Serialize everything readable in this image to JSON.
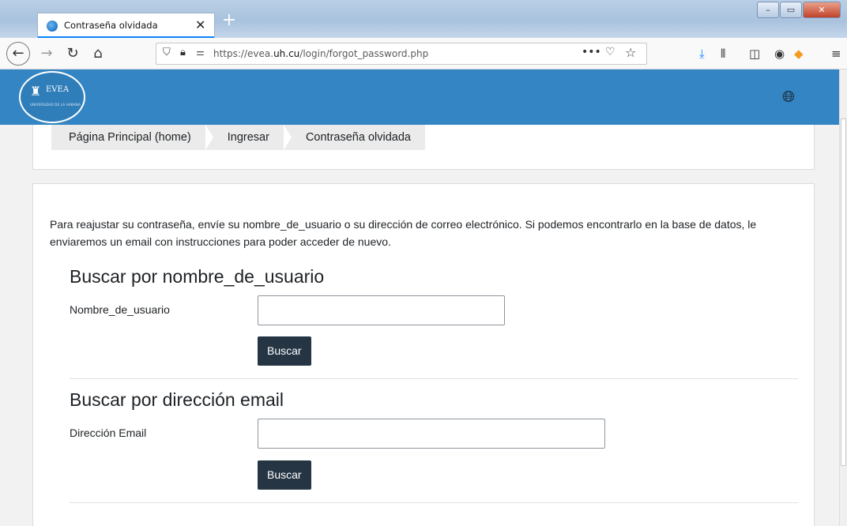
{
  "browser": {
    "tab_title": "Contraseña olvidada",
    "tab_close": "✕",
    "new_tab": "+",
    "url_prefix": "https://evea.",
    "url_domain": "uh.cu",
    "url_path": "/login/forgot_password.php",
    "window_controls": {
      "minimize": "–",
      "maximize": "▭",
      "close": "✕"
    },
    "icons": {
      "back": "back-arrow-icon",
      "forward": "forward-arrow-icon",
      "reload": "reload-icon",
      "home": "home-icon",
      "shield": "shield-icon",
      "lock": "lock-icon",
      "permissions": "permissions-icon",
      "more": "more-dots-icon",
      "pocket": "pocket-icon",
      "bookmark": "star-icon",
      "download": "download-icon",
      "library": "library-icon",
      "sidebar": "sidebar-icon",
      "menu": "hamburger-menu-icon"
    },
    "accent_color": "#0a84ff"
  },
  "site": {
    "header_color": "#3485c3",
    "logo_text": "EVEA",
    "logo_subtext": "UNIVERSIDAD DE LA HABANA",
    "language_icon": "globe-icon"
  },
  "breadcrumb": [
    {
      "label": "Página Principal (home)"
    },
    {
      "label": "Ingresar"
    },
    {
      "label": "Contraseña olvidada"
    }
  ],
  "main": {
    "instructions": "Para reajustar su contraseña, envíe su nombre_de_usuario o su dirección de correo electrónico. Si podemos encontrarlo en la base de datos, le enviaremos un email con instrucciones para poder acceder de nuevo.",
    "username_section": {
      "title": "Buscar por nombre_de_usuario",
      "label": "Nombre_de_usuario",
      "value": "",
      "button": "Buscar"
    },
    "email_section": {
      "title": "Buscar por dirección email",
      "label": "Dirección Email",
      "value": "",
      "button": "Buscar"
    },
    "button_color": "#253544"
  }
}
